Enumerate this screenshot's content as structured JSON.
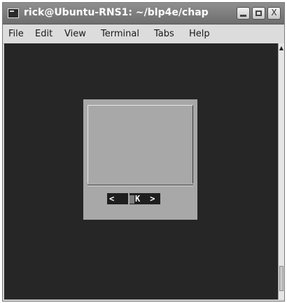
{
  "window": {
    "title": "rick@Ubuntu-RNS1: ~/blp4e/chap",
    "controls": {
      "minimize": "minimize",
      "maximize": "maximize",
      "close": "X"
    }
  },
  "menubar": {
    "items": [
      "File",
      "Edit",
      "View",
      "Terminal",
      "Tabs",
      "Help"
    ]
  },
  "dialog": {
    "button": {
      "left_bracket": "< ",
      "label": "K",
      "right_bracket": " >"
    }
  },
  "scrollbar": {
    "up_arrow": "▲"
  },
  "colors": {
    "terminal_bg": "#262626",
    "dialog_bg": "#a8a8a8",
    "titlebar": "#7e7e7e"
  }
}
